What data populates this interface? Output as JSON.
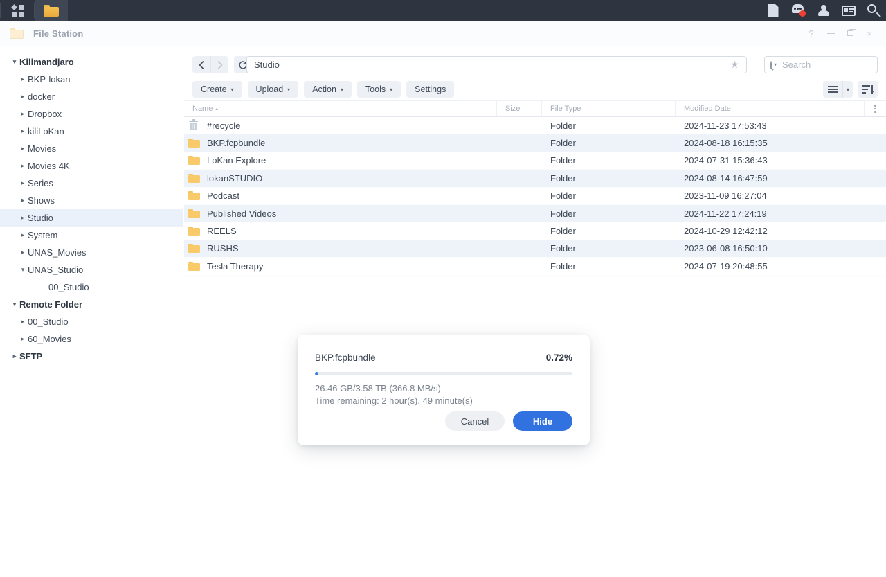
{
  "taskbar": {
    "left_items": [
      {
        "name": "app-launcher",
        "icon": "grid-icon"
      },
      {
        "name": "file-station-taskbar",
        "icon": "folder-icon",
        "active": true
      }
    ],
    "right_items": [
      {
        "name": "notes",
        "icon": "document-icon"
      },
      {
        "name": "notifications",
        "icon": "chat-bubble-icon",
        "badge": true
      },
      {
        "name": "account",
        "icon": "person-icon"
      },
      {
        "name": "widgets",
        "icon": "card-icon"
      },
      {
        "name": "search",
        "icon": "search-icon"
      }
    ]
  },
  "window": {
    "title": "File Station",
    "icon": "folder-icon",
    "controls": {
      "help": "?",
      "minimize": "minimize-icon",
      "maximize": "maximize-icon",
      "close": "×"
    }
  },
  "sidebar": {
    "items": [
      {
        "label": "Kilimandjaro",
        "level": 0,
        "caret": "▾",
        "root": true,
        "expanded": true
      },
      {
        "label": "BKP-lokan",
        "level": 1,
        "caret": "▸"
      },
      {
        "label": "docker",
        "level": 1,
        "caret": "▸"
      },
      {
        "label": "Dropbox",
        "level": 1,
        "caret": "▸"
      },
      {
        "label": "kiliLoKan",
        "level": 1,
        "caret": "▸"
      },
      {
        "label": "Movies",
        "level": 1,
        "caret": "▸"
      },
      {
        "label": "Movies 4K",
        "level": 1,
        "caret": "▸"
      },
      {
        "label": "Series",
        "level": 1,
        "caret": "▸"
      },
      {
        "label": "Shows",
        "level": 1,
        "caret": "▸"
      },
      {
        "label": "Studio",
        "level": 1,
        "caret": "▸",
        "selected": true
      },
      {
        "label": "System",
        "level": 1,
        "caret": "▸"
      },
      {
        "label": "UNAS_Movies",
        "level": 1,
        "caret": "▸"
      },
      {
        "label": "UNAS_Studio",
        "level": 1,
        "caret": "▾",
        "expanded": true
      },
      {
        "label": "00_Studio",
        "level": 2,
        "caret": ""
      },
      {
        "label": "Remote Folder",
        "level": 0,
        "caret": "▾",
        "root": true,
        "expanded": true
      },
      {
        "label": "00_Studio",
        "level": 1,
        "caret": "▸"
      },
      {
        "label": "60_Movies",
        "level": 1,
        "caret": "▸"
      },
      {
        "label": "SFTP",
        "level": 0,
        "caret": "▸",
        "root": true
      }
    ]
  },
  "toolbar": {
    "back_icon": "chevron-left-icon",
    "forward_icon": "chevron-right-icon",
    "refresh_icon": "refresh-icon",
    "path_value": "Studio",
    "path_placeholder": "",
    "favorite_icon": "star-icon",
    "search_placeholder": "Search",
    "search_value": "",
    "buttons": [
      {
        "label": "Create",
        "dropdown": true
      },
      {
        "label": "Upload",
        "dropdown": true
      },
      {
        "label": "Action",
        "dropdown": true
      },
      {
        "label": "Tools",
        "dropdown": true
      },
      {
        "label": "Settings",
        "dropdown": false
      }
    ],
    "view_mode_icon": "list-view-icon",
    "view_mode_caret": "▾",
    "sort_icon": "sort-descending-icon"
  },
  "file_list": {
    "columns": [
      {
        "key": "name",
        "label": "Name",
        "sort": "asc",
        "sort_glyph": "▴"
      },
      {
        "key": "size",
        "label": "Size"
      },
      {
        "key": "type",
        "label": "File Type"
      },
      {
        "key": "date",
        "label": "Modified Date"
      }
    ],
    "column_menu_icon": "kebab-menu-icon",
    "rows": [
      {
        "name": "#recycle",
        "icon": "trash-icon",
        "size": "",
        "type": "Folder",
        "date": "2024-11-23 17:53:43"
      },
      {
        "name": "BKP.fcpbundle",
        "icon": "folder-icon",
        "size": "",
        "type": "Folder",
        "date": "2024-08-18 16:15:35"
      },
      {
        "name": "LoKan Explore",
        "icon": "folder-icon",
        "size": "",
        "type": "Folder",
        "date": "2024-07-31 15:36:43"
      },
      {
        "name": "lokanSTUDIO",
        "icon": "folder-icon",
        "size": "",
        "type": "Folder",
        "date": "2024-08-14 16:47:59"
      },
      {
        "name": "Podcast",
        "icon": "folder-icon",
        "size": "",
        "type": "Folder",
        "date": "2023-11-09 16:27:04"
      },
      {
        "name": "Published Videos",
        "icon": "folder-icon",
        "size": "",
        "type": "Folder",
        "date": "2024-11-22 17:24:19"
      },
      {
        "name": "REELS",
        "icon": "folder-icon",
        "size": "",
        "type": "Folder",
        "date": "2024-10-29 12:42:12"
      },
      {
        "name": "RUSHS",
        "icon": "folder-icon",
        "size": "",
        "type": "Folder",
        "date": "2023-06-08 16:50:10"
      },
      {
        "name": "Tesla Therapy",
        "icon": "folder-icon",
        "size": "",
        "type": "Folder",
        "date": "2024-07-19 20:48:55"
      }
    ]
  },
  "progress_dialog": {
    "file_name": "BKP.fcpbundle",
    "percent_label": "0.72%",
    "percent_value": 0.72,
    "transferred": "26.46 GB/3.58 TB (366.8 MB/s)",
    "time_remaining": "Time remaining: 2 hour(s), 49 minute(s)",
    "cancel_label": "Cancel",
    "hide_label": "Hide"
  },
  "colors": {
    "accent": "#3272e0",
    "progress_bar": "#3f7fe0",
    "taskbar": "#2e3440",
    "row_alt": "#eef3fa",
    "selection": "#eaf1fb",
    "folder_icon": "#f8ca6a",
    "badge": "#ef4036"
  }
}
